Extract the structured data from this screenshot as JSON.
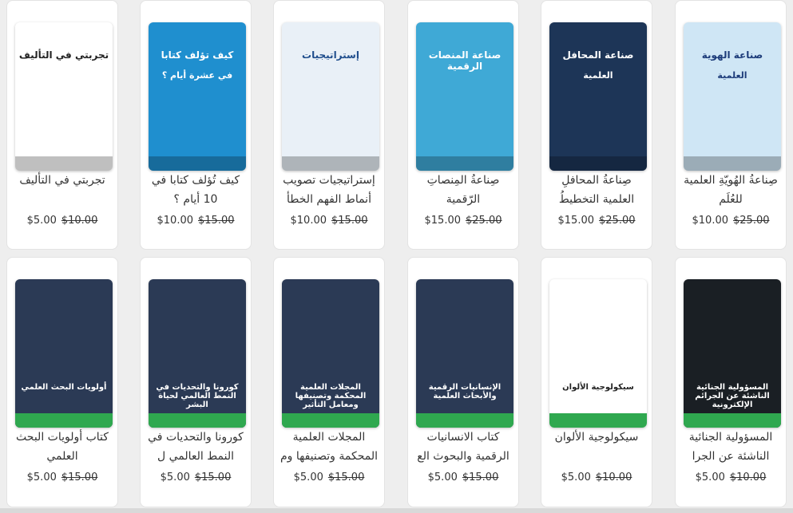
{
  "products": [
    {
      "title": "تجربتي في التأليف",
      "price": "$5.00",
      "old_price": "$10.00",
      "cover": {
        "top": "تجربتي في التأليف",
        "bottom": "",
        "bg": "#ffffff",
        "fg": "#222222"
      }
    },
    {
      "title": "كيف تُؤلف كتابا في 10 أيام ؟",
      "price": "$10.00",
      "old_price": "$15.00",
      "cover": {
        "top": "كيف تؤلف كتابا",
        "bottom": "في عشرة أيام ؟",
        "bg": "#1f8fcf",
        "fg": "#ffffff"
      }
    },
    {
      "title": "إستراتيجيات تصويب أنماط الفهم الخطأ",
      "price": "$10.00",
      "old_price": "$15.00",
      "cover": {
        "top": "إستراتيجيات",
        "bottom": "",
        "bg": "#e9f0f7",
        "fg": "#1f4d8c"
      }
    },
    {
      "title": "صِناعةُ المِنصاتِ الرّقمية",
      "price": "$15.00",
      "old_price": "$25.00",
      "cover": {
        "top": "صناعة المنصات الرقمية",
        "bottom": "",
        "bg": "#3fa9d6",
        "fg": "#ffffff"
      }
    },
    {
      "title": "صِناعةُ المحافلِ العلمية التخطيطُ",
      "price": "$15.00",
      "old_price": "$25.00",
      "cover": {
        "top": "صناعة المحافل",
        "bottom": "العلمية",
        "bg": "#1d3557",
        "fg": "#ffffff"
      }
    },
    {
      "title": "صِناعةُ الهُويّةِ العلمية للعُلَم",
      "price": "$10.00",
      "old_price": "$25.00",
      "cover": {
        "top": "صناعة الهوية",
        "bottom": "العلمية",
        "bg": "#cfe6f5",
        "fg": "#1d3c7a"
      }
    },
    {
      "title": "كتاب أولويات البحث العلمي",
      "price": "$5.00",
      "old_price": "$15.00",
      "cover": {
        "top": "",
        "bottom": "أولويات البحث العلمي",
        "bg": "#2b3a55",
        "fg": "#ffffff"
      }
    },
    {
      "title": "كورونا والتحديات في النمط العالمي ل",
      "price": "$5.00",
      "old_price": "$15.00",
      "cover": {
        "top": "",
        "bottom": "كورونا والتحديات في النمط العالمي لحياة البشر",
        "bg": "#2b3a55",
        "fg": "#ffffff"
      }
    },
    {
      "title": "المجلات العلمية المحكمة وتصنيفها وم",
      "price": "$5.00",
      "old_price": "$15.00",
      "cover": {
        "top": "",
        "bottom": "المجلات العلمية المحكمة وتصنيفها ومعامل التأثير",
        "bg": "#2b3a55",
        "fg": "#ffffff"
      }
    },
    {
      "title": "كتاب الانسانيات الرقمية والبحوث الع",
      "price": "$5.00",
      "old_price": "$15.00",
      "cover": {
        "top": "",
        "bottom": "الإنسانيات الرقمية والأبحاث العلمية",
        "bg": "#2b3a55",
        "fg": "#ffffff"
      }
    },
    {
      "title": "سيكولوجية الألوان",
      "price": "$5.00",
      "old_price": "$10.00",
      "cover": {
        "top": "",
        "bottom": "سيكولوجية الألوان",
        "bg": "#ffffff",
        "fg": "#222222"
      }
    },
    {
      "title": "المسؤولية الجنائية الناشئة عن الجرا",
      "price": "$5.00",
      "old_price": "$10.00",
      "cover": {
        "top": "",
        "bottom": "المسؤولية الجنائية الناشئة عن الجرائم الإلكترونية",
        "bg": "#1a1f24",
        "fg": "#ffffff"
      }
    }
  ]
}
